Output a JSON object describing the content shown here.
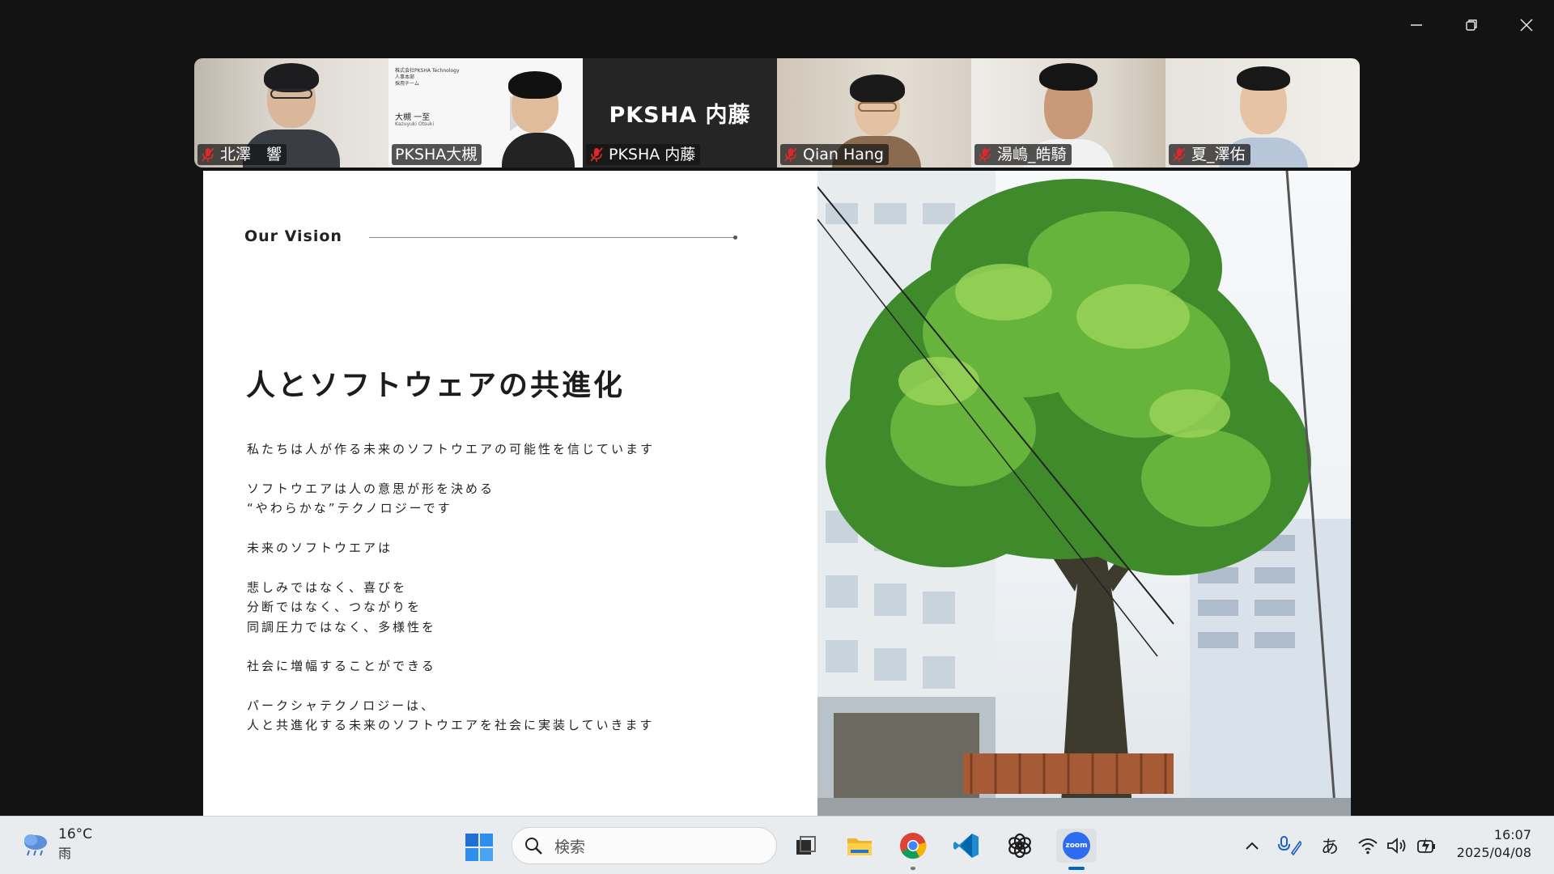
{
  "window": {
    "controls": [
      "minimize",
      "restore",
      "close"
    ]
  },
  "participants": [
    {
      "name": "北澤　響",
      "muted": true,
      "active": false
    },
    {
      "name": "PKSHA大槻",
      "muted": false,
      "active": true,
      "badge": {
        "company": "株式会社PKSHA Technology",
        "dept": "人事本部",
        "team": "採用チーム",
        "person": "大槻 一至",
        "romaji": "Kazuyuki Otsuki"
      }
    },
    {
      "name": "PKSHA 内藤",
      "muted": true,
      "active": false,
      "display_name": "PKSHA 内藤"
    },
    {
      "name": "Qian Hang",
      "muted": true,
      "active": false
    },
    {
      "name": "湯嶋_皓騎",
      "muted": true,
      "active": false
    },
    {
      "name": "夏_澤佑",
      "muted": true,
      "active": false
    }
  ],
  "slide": {
    "label": "Our Vision",
    "headline": "人とソフトウェアの共進化",
    "paragraphs": [
      [
        "私たちは人が作る未来のソフトウエアの可能性を信じています"
      ],
      [
        "ソフトウエアは人の意思が形を決める",
        "“やわらかな”テクノロジーです"
      ],
      [
        "未来のソフトウエアは"
      ],
      [
        "悲しみではなく、喜びを",
        "分断ではなく、つながりを",
        "同調圧力ではなく、多様性を"
      ],
      [
        "社会に増幅することができる"
      ],
      [
        "パークシャテクノロジーは、",
        "人と共進化する未来のソフトウエアを社会に実装していきます"
      ]
    ]
  },
  "taskbar": {
    "weather": {
      "temp": "16°C",
      "condition": "雨",
      "icon": "rain-cloud-icon"
    },
    "search_placeholder": "検索",
    "apps": [
      "task-view",
      "file-explorer",
      "chrome",
      "vscode",
      "chatgpt",
      "zoom"
    ],
    "zoom_label": "zoom",
    "ime": "あ",
    "time": "16:07",
    "date": "2025/04/08"
  }
}
